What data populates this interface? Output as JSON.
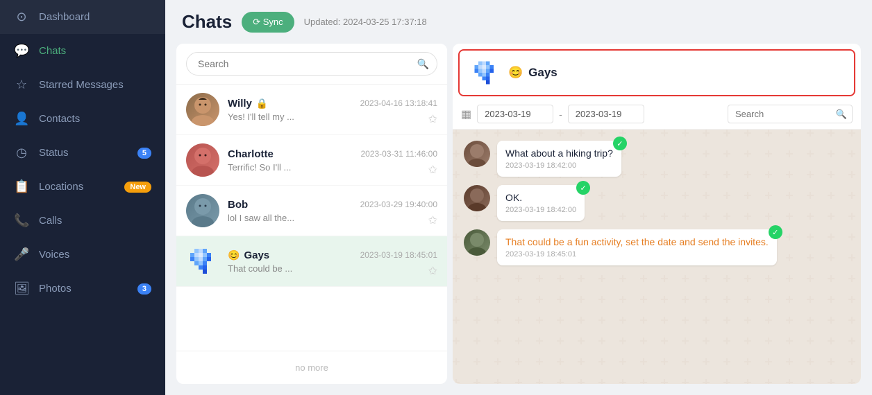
{
  "sidebar": {
    "items": [
      {
        "id": "dashboard",
        "label": "Dashboard",
        "icon": "⊙",
        "active": false
      },
      {
        "id": "chats",
        "label": "Chats",
        "icon": "💬",
        "active": true
      },
      {
        "id": "starred",
        "label": "Starred Messages",
        "icon": "☆",
        "active": false
      },
      {
        "id": "contacts",
        "label": "Contacts",
        "icon": "👤",
        "active": false
      },
      {
        "id": "status",
        "label": "Status",
        "icon": "◷",
        "badge": "5",
        "badgeType": "blue",
        "active": false
      },
      {
        "id": "locations",
        "label": "Locations",
        "icon": "📋",
        "badge": "New",
        "badgeType": "orange",
        "active": false
      },
      {
        "id": "calls",
        "label": "Calls",
        "icon": "📞",
        "active": false
      },
      {
        "id": "voices",
        "label": "Voices",
        "icon": "🎤",
        "active": false
      },
      {
        "id": "photos",
        "label": "Photos",
        "icon": "🖼",
        "badge": "3",
        "badgeType": "blue",
        "active": false
      }
    ]
  },
  "header": {
    "title": "Chats",
    "sync_label": "⟳ Sync",
    "updated_text": "Updated: 2024-03-25 17:37:18"
  },
  "chat_list": {
    "search_placeholder": "Search",
    "items": [
      {
        "id": "willy",
        "name": "Willy",
        "has_lock": true,
        "time": "2023-04-16 13:18:41",
        "preview": "Yes! I'll tell my ...",
        "active": false
      },
      {
        "id": "charlotte",
        "name": "Charlotte",
        "has_lock": false,
        "time": "2023-03-31 11:46:00",
        "preview": "Terrific! So I'll ...",
        "active": false
      },
      {
        "id": "bob",
        "name": "Bob",
        "has_lock": false,
        "time": "2023-03-29 19:40:00",
        "preview": "lol I saw all the...",
        "active": false
      },
      {
        "id": "gays",
        "name": "Gays",
        "has_lock": false,
        "emoji": "😊",
        "time": "2023-03-19 18:45:01",
        "preview": "That could be ...",
        "active": true
      }
    ],
    "no_more": "no more"
  },
  "chat_detail": {
    "header_name": "Gays",
    "header_emoji": "😊",
    "date_from": "2023-03-19",
    "date_to": "2023-03-19",
    "search_placeholder": "Search",
    "messages": [
      {
        "id": "msg1",
        "text": "What about a hiking trip?",
        "time": "2023-03-19 18:42:00",
        "has_wa": true
      },
      {
        "id": "msg2",
        "text": "OK.",
        "time": "2023-03-19 18:42:00",
        "has_wa": true
      },
      {
        "id": "msg3",
        "text": "That could be a fun activity, set the date and send the invites.",
        "time": "2023-03-19 18:45:01",
        "has_wa": true,
        "orange": true
      }
    ]
  }
}
